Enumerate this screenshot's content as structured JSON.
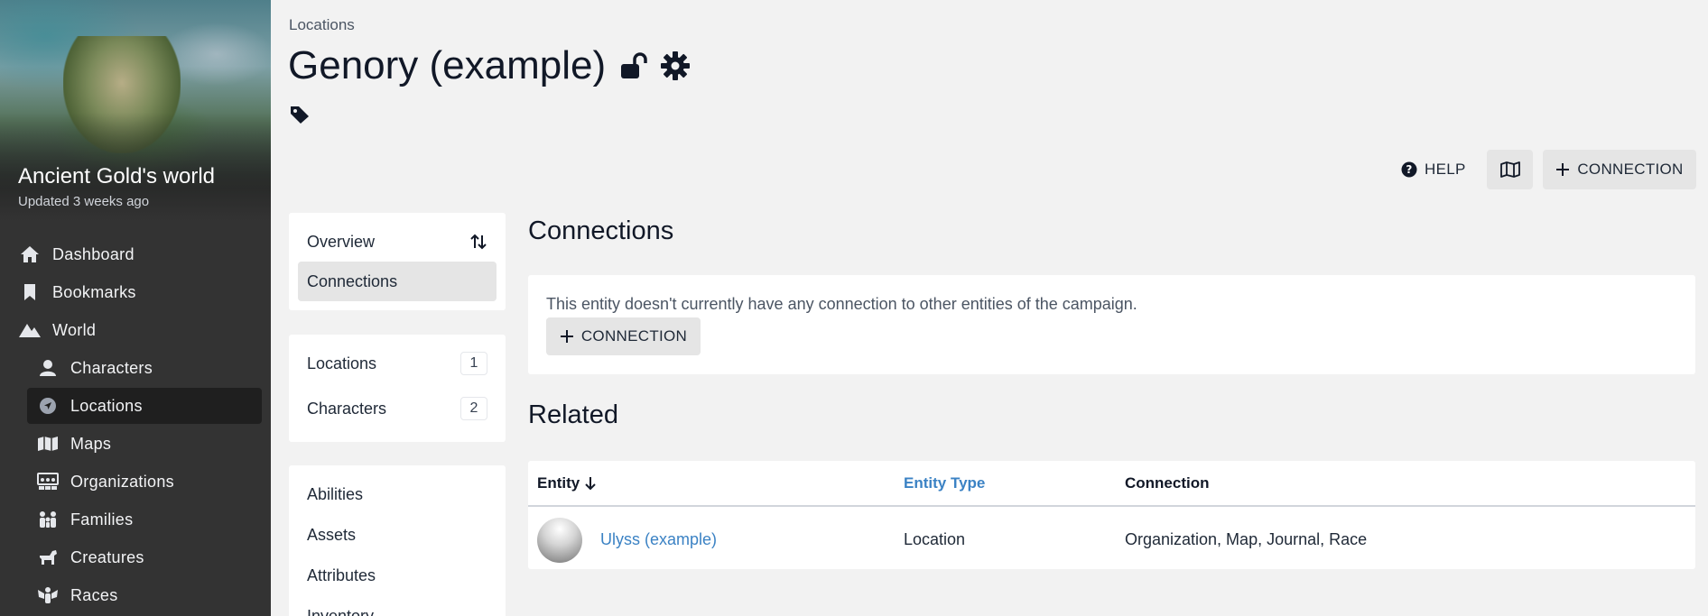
{
  "sidebar": {
    "world_title": "Ancient Gold's world",
    "world_updated": "Updated 3 weeks ago",
    "items": [
      {
        "label": "Dashboard",
        "icon": "home-icon"
      },
      {
        "label": "Bookmarks",
        "icon": "bookmark-icon"
      },
      {
        "label": "World",
        "icon": "mountain-icon"
      },
      {
        "label": "Characters",
        "icon": "user-icon"
      },
      {
        "label": "Locations",
        "icon": "location-arrow-icon",
        "active": true
      },
      {
        "label": "Maps",
        "icon": "map-icon"
      },
      {
        "label": "Organizations",
        "icon": "organization-icon"
      },
      {
        "label": "Families",
        "icon": "family-icon"
      },
      {
        "label": "Creatures",
        "icon": "creature-icon"
      },
      {
        "label": "Races",
        "icon": "race-icon"
      }
    ]
  },
  "header": {
    "breadcrumb": "Locations",
    "title": "Genory (example)",
    "icons": [
      "unlock-icon",
      "gear-icon",
      "tag-icon"
    ]
  },
  "toolbar": {
    "help_label": "HELP",
    "map_icon": "map-icon",
    "connection_label": "CONNECTION"
  },
  "side_menu": {
    "group1": [
      {
        "label": "Overview"
      },
      {
        "label": "Connections",
        "selected": true
      }
    ],
    "group2": [
      {
        "label": "Locations",
        "count": "1"
      },
      {
        "label": "Characters",
        "count": "2"
      }
    ],
    "group3": [
      {
        "label": "Abilities"
      },
      {
        "label": "Assets"
      },
      {
        "label": "Attributes"
      },
      {
        "label": "Inventory"
      }
    ]
  },
  "connections": {
    "heading": "Connections",
    "empty_text": "This entity doesn't currently have any connection to other entities of the campaign.",
    "button_label": "CONNECTION"
  },
  "related": {
    "heading": "Related",
    "columns": [
      "Entity",
      "Entity Type",
      "Connection"
    ],
    "rows": [
      {
        "entity": "Ulyss (example)",
        "type": "Location",
        "connection": "Organization, Map, Journal, Race"
      }
    ]
  },
  "colors": {
    "sidebar_bg": "#333333",
    "page_bg": "#f2f2f2",
    "link": "#3b82c4"
  }
}
